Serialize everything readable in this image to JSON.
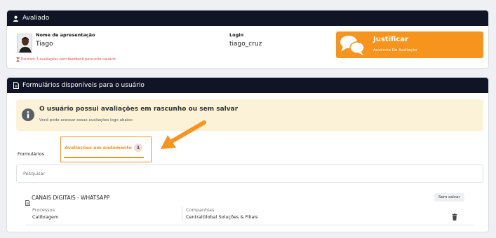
{
  "evaluated": {
    "title": "Avaliado",
    "name_label": "Nome de apresentação",
    "name_value": "Tiago",
    "login_label": "Login",
    "login_value": "tiago_cruz",
    "warning": "Existem 3 avaliações sem feedback para este usuário",
    "justify_title": "Justificar",
    "justify_subtitle": "Ausência De Avaliação"
  },
  "forms": {
    "title": "Formulários disponíveis para o usuário",
    "alert_title": "O usuário possui avaliações em rascunho ou sem salvar",
    "alert_text": "Você pode acessar essas avaliações logo abaixo",
    "tabs": [
      {
        "label": "Formulários"
      },
      {
        "label": "Avaliações em andamento",
        "badge": "1"
      }
    ],
    "search_placeholder": "Pesquisar",
    "item": {
      "title": "CANAIS DIGITAIS - WHATSAPP",
      "status": "Sem salvar",
      "process_label": "Processos",
      "process_value": "Calibragem",
      "company_label": "Companhias",
      "company_value": "CentralGlobal Soluções & Filiais"
    }
  },
  "colors": {
    "header": "#111424",
    "accent": "#f7941d",
    "alert_bg": "#fbf2d8",
    "warning": "#d9534f"
  }
}
